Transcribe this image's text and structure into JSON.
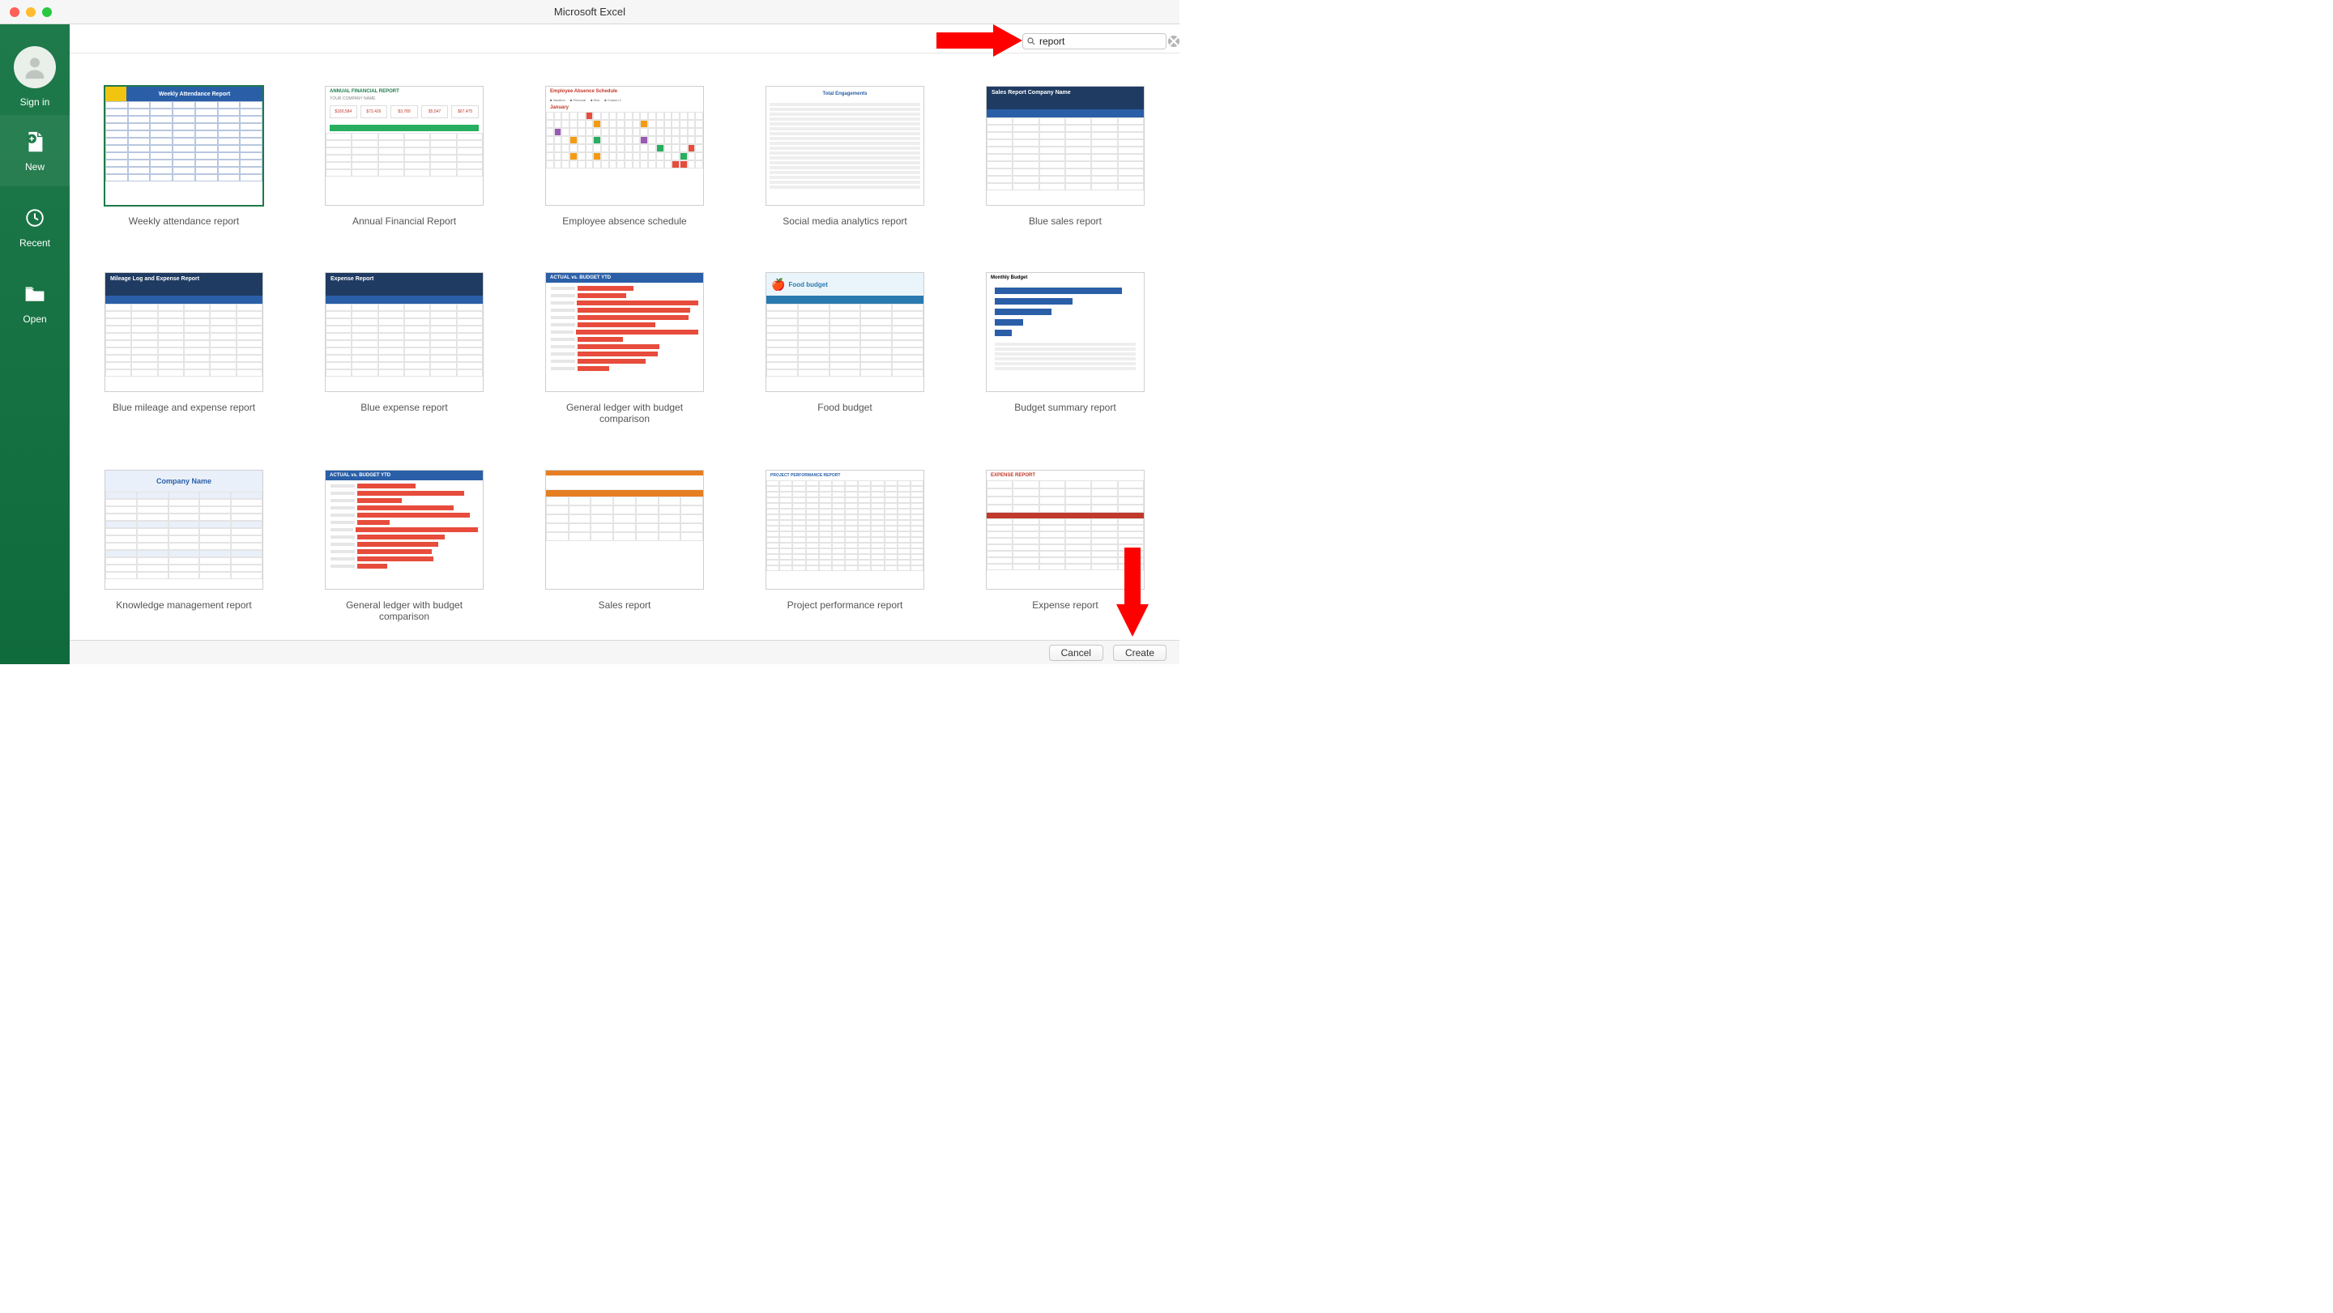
{
  "window": {
    "title": "Microsoft Excel"
  },
  "sidebar": {
    "sign_in": "Sign in",
    "new": "New",
    "recent": "Recent",
    "open": "Open"
  },
  "search": {
    "value": "report"
  },
  "templates": [
    {
      "id": "weekly-attendance",
      "label": "Weekly attendance report",
      "selected": true
    },
    {
      "id": "annual-financial",
      "label": "Annual Financial Report",
      "selected": false
    },
    {
      "id": "employee-absence",
      "label": "Employee absence schedule",
      "selected": false
    },
    {
      "id": "social-media-analytics",
      "label": "Social media analytics report",
      "selected": false
    },
    {
      "id": "blue-sales",
      "label": "Blue sales report",
      "selected": false
    },
    {
      "id": "blue-mileage-expense",
      "label": "Blue mileage and expense report",
      "selected": false
    },
    {
      "id": "blue-expense",
      "label": "Blue expense report",
      "selected": false
    },
    {
      "id": "general-ledger-budget-1",
      "label": "General ledger with budget comparison",
      "selected": false
    },
    {
      "id": "food-budget",
      "label": "Food budget",
      "selected": false
    },
    {
      "id": "budget-summary",
      "label": "Budget summary report",
      "selected": false
    },
    {
      "id": "knowledge-management",
      "label": "Knowledge management report",
      "selected": false
    },
    {
      "id": "general-ledger-budget-2",
      "label": "General ledger with budget comparison",
      "selected": false
    },
    {
      "id": "sales-report",
      "label": "Sales report",
      "selected": false
    },
    {
      "id": "project-performance",
      "label": "Project performance report",
      "selected": false
    },
    {
      "id": "expense-report",
      "label": "Expense report",
      "selected": false
    }
  ],
  "thumb_titles": {
    "weekly-attendance": "Weekly Attendance Report",
    "annual-financial": "ANNUAL FINANCIAL REPORT",
    "employee-absence": "Employee Absence Schedule",
    "social-media-analytics": "Total Engagements",
    "blue-sales": "Sales Report",
    "blue-mileage-expense": "Mileage Log and Expense Report",
    "blue-expense": "Expense Report",
    "general-ledger-budget-1": "ACTUAL vs. BUDGET YTD",
    "food-budget": "Food budget",
    "budget-summary": "Monthly Budget",
    "knowledge-management": "Company Name",
    "general-ledger-budget-2": "ACTUAL vs. BUDGET YTD",
    "sales-report": "",
    "project-performance": "PROJECT PERFORMANCE REPORT",
    "expense-report": "EXPENSE REPORT"
  },
  "footer": {
    "cancel": "Cancel",
    "create": "Create"
  },
  "colors": {
    "excel_green": "#1e7a4a",
    "arrow_red": "#fe0000"
  }
}
